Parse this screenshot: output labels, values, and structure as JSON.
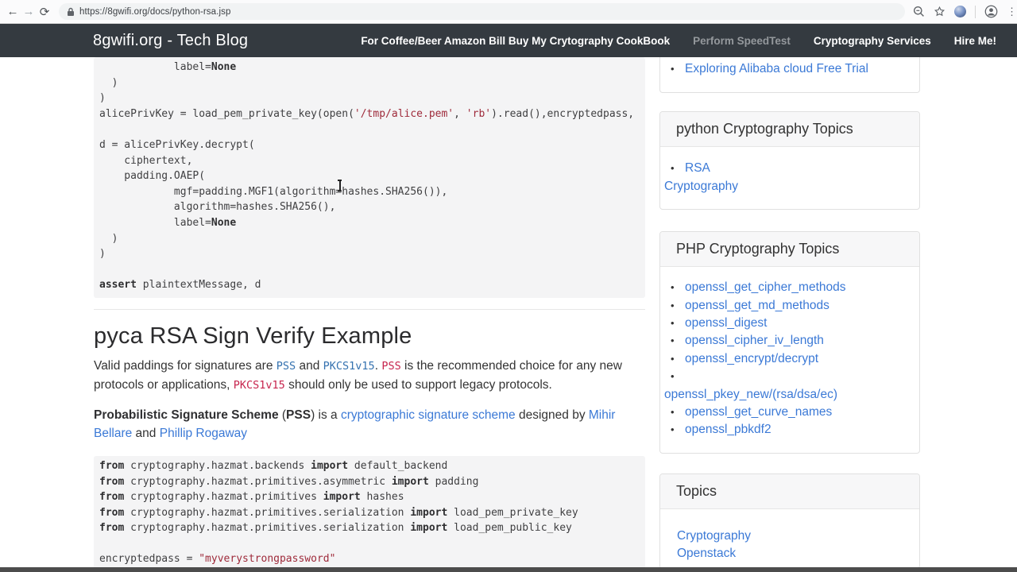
{
  "browser": {
    "url": "https://8gwifi.org/docs/python-rsa.jsp",
    "icons": [
      "back-icon",
      "forward-icon",
      "reload-icon",
      "lock-icon",
      "zoom-icon",
      "star-icon",
      "extension-sphere-icon",
      "avatar-icon",
      "menu-dots-icon"
    ],
    "menu_dots": "⋮",
    "back_glyph": "←",
    "forward_glyph": "→",
    "reload_glyph": "⟳"
  },
  "navbar": {
    "brand": "8gwifi.org - Tech Blog",
    "items": [
      {
        "label": "For Coffee/Beer Amazon Bill Buy My Crytography CookBook",
        "muted": false
      },
      {
        "label": "Perform SpeedTest",
        "muted": true
      },
      {
        "label": "Cryptography Services",
        "muted": false
      },
      {
        "label": "Hire Me!",
        "muted": false
      }
    ]
  },
  "main": {
    "code_block_1": {
      "lines": [
        [
          {
            "k": "t",
            "s": "            label="
          },
          {
            "k": "b",
            "s": "None"
          }
        ],
        [
          {
            "k": "t",
            "s": "  )"
          }
        ],
        [
          {
            "k": "t",
            "s": ")"
          }
        ],
        [
          {
            "k": "t",
            "s": "alicePrivKey = load_pem_private_key(open("
          },
          {
            "k": "s",
            "s": "'/tmp/alice.pem'"
          },
          {
            "k": "t",
            "s": ", "
          },
          {
            "k": "s",
            "s": "'rb'"
          },
          {
            "k": "t",
            "s": ").read(),encryptedpass,"
          }
        ],
        [],
        [
          {
            "k": "t",
            "s": "d = alicePrivKey.decrypt("
          }
        ],
        [
          {
            "k": "t",
            "s": "    ciphertext,"
          }
        ],
        [
          {
            "k": "t",
            "s": "    padding.OAEP("
          }
        ],
        [
          {
            "k": "t",
            "s": "            mgf=padding.MGF1(algorithm=hashes.SHA256()),"
          }
        ],
        [
          {
            "k": "t",
            "s": "            algorithm=hashes.SHA256(),"
          }
        ],
        [
          {
            "k": "t",
            "s": "            label="
          },
          {
            "k": "b",
            "s": "None"
          }
        ],
        [
          {
            "k": "t",
            "s": "  )"
          }
        ],
        [
          {
            "k": "t",
            "s": ")"
          }
        ],
        [],
        [
          {
            "k": "b",
            "s": "assert"
          },
          {
            "k": "t",
            "s": " plaintextMessage, d"
          }
        ]
      ]
    },
    "heading": "pyca RSA Sign Verify Example",
    "para1": [
      {
        "k": "t",
        "s": "Valid paddings for signatures are "
      },
      {
        "k": "code-link",
        "s": "PSS"
      },
      {
        "k": "t",
        "s": " and "
      },
      {
        "k": "code-link",
        "s": "PKCS1v15"
      },
      {
        "k": "t",
        "s": ". "
      },
      {
        "k": "code",
        "s": "PSS"
      },
      {
        "k": "t",
        "s": " is the recommended choice for any new protocols or applications, "
      },
      {
        "k": "code",
        "s": "PKCS1v15"
      },
      {
        "k": "t",
        "s": " should only be used to support legacy protocols."
      }
    ],
    "para2": [
      {
        "k": "b",
        "s": "Probabilistic Signature Scheme"
      },
      {
        "k": "t",
        "s": " ("
      },
      {
        "k": "b",
        "s": "PSS"
      },
      {
        "k": "t",
        "s": ") is a "
      },
      {
        "k": "link",
        "s": "cryptographic signature scheme"
      },
      {
        "k": "t",
        "s": " designed by "
      },
      {
        "k": "link",
        "s": "Mihir Bellare"
      },
      {
        "k": "t",
        "s": " and "
      },
      {
        "k": "link",
        "s": "Phillip Rogaway"
      }
    ],
    "code_block_2": {
      "lines": [
        [
          {
            "k": "b",
            "s": "from"
          },
          {
            "k": "t",
            "s": " cryptography.hazmat.backends "
          },
          {
            "k": "b",
            "s": "import"
          },
          {
            "k": "t",
            "s": " default_backend"
          }
        ],
        [
          {
            "k": "b",
            "s": "from"
          },
          {
            "k": "t",
            "s": " cryptography.hazmat.primitives.asymmetric "
          },
          {
            "k": "b",
            "s": "import"
          },
          {
            "k": "t",
            "s": " padding"
          }
        ],
        [
          {
            "k": "b",
            "s": "from"
          },
          {
            "k": "t",
            "s": " cryptography.hazmat.primitives "
          },
          {
            "k": "b",
            "s": "import"
          },
          {
            "k": "t",
            "s": " hashes"
          }
        ],
        [
          {
            "k": "b",
            "s": "from"
          },
          {
            "k": "t",
            "s": " cryptography.hazmat.primitives.serialization "
          },
          {
            "k": "b",
            "s": "import"
          },
          {
            "k": "t",
            "s": " load_pem_private_key"
          }
        ],
        [
          {
            "k": "b",
            "s": "from"
          },
          {
            "k": "t",
            "s": " cryptography.hazmat.primitives.serialization "
          },
          {
            "k": "b",
            "s": "import"
          },
          {
            "k": "t",
            "s": " load_pem_public_key"
          }
        ],
        [],
        [
          {
            "k": "t",
            "s": "encryptedpass = "
          },
          {
            "k": "s",
            "s": "\"myverystrongpassword\""
          }
        ]
      ]
    }
  },
  "sidebar": {
    "card_recent": {
      "items": [
        {
          "lines": [
            "Exploring Alibaba cloud Free Trial"
          ]
        }
      ]
    },
    "card_python": {
      "title": "python Cryptography Topics",
      "items": [
        {
          "lines": [
            "RSA",
            "Cryptography"
          ]
        }
      ]
    },
    "card_php": {
      "title": "PHP Cryptography Topics",
      "items": [
        {
          "lines": [
            "openssl_get_cipher_methods"
          ]
        },
        {
          "lines": [
            "openssl_get_md_methods"
          ]
        },
        {
          "lines": [
            "openssl_digest"
          ]
        },
        {
          "lines": [
            "openssl_cipher_iv_length"
          ]
        },
        {
          "lines": [
            "openssl_encrypt/decrypt"
          ]
        },
        {
          "lines": [
            "",
            "openssl_pkey_new/(rsa/dsa/ec)"
          ]
        },
        {
          "lines": [
            "openssl_get_curve_names"
          ]
        },
        {
          "lines": [
            "openssl_pbkdf2"
          ]
        }
      ]
    },
    "card_topics": {
      "title": "Topics",
      "items": [
        "Cryptography",
        "Openstack"
      ]
    }
  },
  "colors": {
    "navbar_bg": "#343a40",
    "link_blue": "#3b79d6",
    "code_link_blue": "#3572b0",
    "inline_code_pink": "#c7254e",
    "code_string_red": "#9e2a3a",
    "code_bg": "#f4f4f5"
  }
}
